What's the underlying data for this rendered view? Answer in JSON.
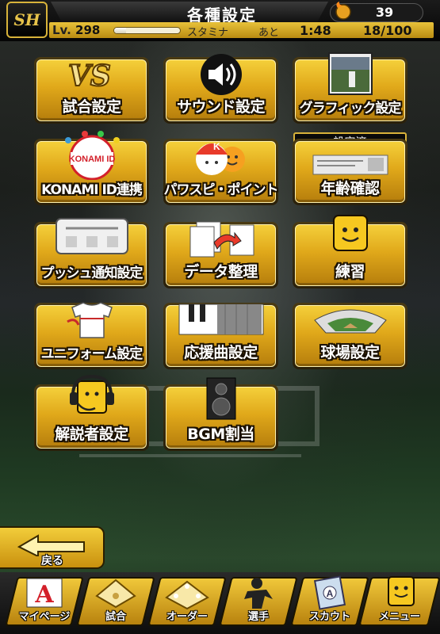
{
  "header": {
    "team_logo_text": "SH",
    "title": "各種設定",
    "coin_count": "39",
    "level_prefix": "Lv.",
    "level_value": "298",
    "stamina_label": "スタミナ",
    "stamina_fill_fraction": 0.18,
    "ato_label": "あと",
    "time_remaining": "1:48",
    "stamina_count": "18/100"
  },
  "menu": {
    "match_settings": "試合設定",
    "sound_settings": "サウンド設定",
    "graphic_settings": "グラフィック設定",
    "konami_id_link": "KONAMI ID連携",
    "konami_logo": "KONAMI ID",
    "pawaspi_point": "パワスピ・ポイント",
    "age_confirm": "年齢確認",
    "age_badge": "設定済",
    "push_settings": "プッシュ通知設定",
    "data_organize": "データ整理",
    "practice": "練習",
    "uniform_settings": "ユニフォーム設定",
    "cheer_song_settings": "応援曲設定",
    "stadium_settings": "球場設定",
    "commentator_settings": "解説者設定",
    "bgm_assign": "BGM割当",
    "vs_text": "VS"
  },
  "back_label": "戻る",
  "nav": {
    "mypage": "マイページ",
    "match": "試合",
    "order": "オーダー",
    "player": "選手",
    "scout": "スカウト",
    "menu": "メニュー"
  },
  "colors": {
    "gold_top": "#f4cf3a",
    "gold_bottom": "#b57d0c",
    "header_bg": "#050505"
  }
}
